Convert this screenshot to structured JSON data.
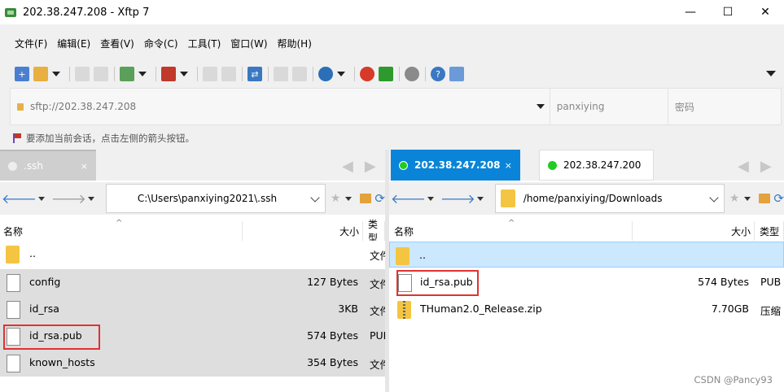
{
  "window": {
    "title": "202.38.247.208 - Xftp 7",
    "min": "—",
    "max": "☐",
    "close": "✕"
  },
  "menu": [
    "文件(F)",
    "编辑(E)",
    "查看(V)",
    "命令(C)",
    "工具(T)",
    "窗口(W)",
    "帮助(H)"
  ],
  "address": {
    "value": "sftp://202.38.247.208",
    "username": "panxiying",
    "password_placeholder": "密码"
  },
  "hint": "要添加当前会话，点击左侧的箭头按钮。",
  "left": {
    "tab": {
      "label": ".ssh",
      "close": "×"
    },
    "path": "C:\\Users\\panxiying2021\\.ssh",
    "columns": {
      "name": "名称",
      "size": "大小",
      "type": "类型"
    },
    "rows": [
      {
        "name": "..",
        "size": "",
        "type": "文件",
        "kind": "folder"
      },
      {
        "name": "config",
        "size": "127 Bytes",
        "type": "文件",
        "kind": "file"
      },
      {
        "name": "id_rsa",
        "size": "3KB",
        "type": "文件",
        "kind": "file"
      },
      {
        "name": "id_rsa.pub",
        "size": "574 Bytes",
        "type": "PUB",
        "kind": "file"
      },
      {
        "name": "known_hosts",
        "size": "354 Bytes",
        "type": "文件",
        "kind": "file"
      }
    ]
  },
  "right": {
    "tabs": [
      {
        "label": "202.38.247.208",
        "close": "×",
        "active": true
      },
      {
        "label": "202.38.247.200",
        "active": false
      }
    ],
    "path": "/home/panxiying/Downloads",
    "columns": {
      "name": "名称",
      "size": "大小",
      "type": "类型"
    },
    "rows": [
      {
        "name": "..",
        "size": "",
        "type": "",
        "kind": "folder"
      },
      {
        "name": "id_rsa.pub",
        "size": "574 Bytes",
        "type": "PUB",
        "kind": "file"
      },
      {
        "name": "THuman2.0_Release.zip",
        "size": "7.70GB",
        "type": "压缩",
        "kind": "zip"
      }
    ]
  },
  "watermark": "CSDN @Pancy93",
  "colors": {
    "active_tab": "#0a84d8",
    "highlight_box": "#e03232",
    "online_dot": "#22cc22"
  }
}
